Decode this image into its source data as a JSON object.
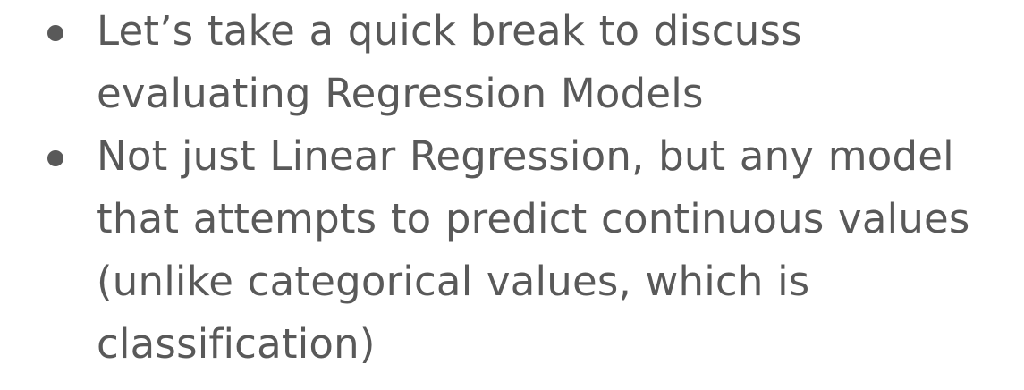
{
  "bullets": [
    {
      "text": "Let’s take a quick break to discuss evaluating Regression Models"
    },
    {
      "text": "Not just Linear Regression, but any model that attempts to predict continuous values (unlike categorical values, which is classification)"
    }
  ],
  "colors": {
    "text": "#595959",
    "background": "#ffffff"
  }
}
